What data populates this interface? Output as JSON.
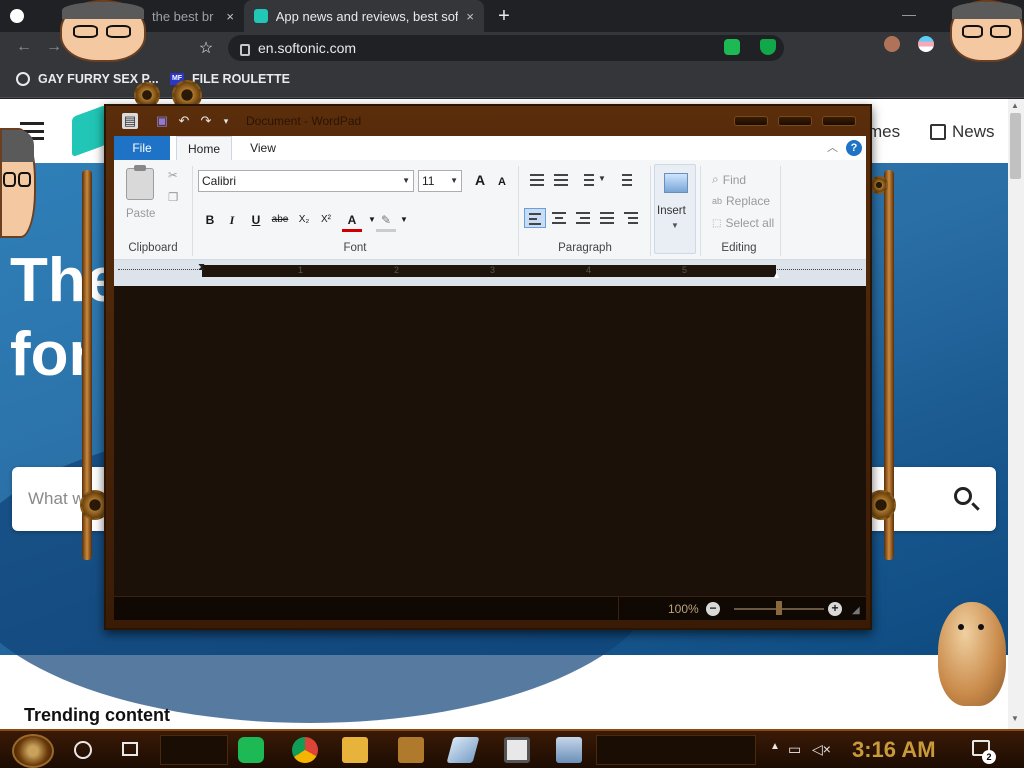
{
  "browser": {
    "tabs": [
      {
        "title": "the best br",
        "close": "×"
      },
      {
        "title": "App news and reviews, best soft",
        "close": "×"
      }
    ],
    "new_tab": "+",
    "minimize": "—",
    "address": "en.softonic.com",
    "bookmarks": [
      {
        "label": "GAY FURRY SEX P..."
      },
      {
        "label": "FILE ROULETTE",
        "badge": "MF"
      }
    ]
  },
  "page": {
    "nav": [
      "mes",
      "News"
    ],
    "hero_lines": [
      "The",
      "for"
    ],
    "search_placeholder": "What wo",
    "section_title": "Trending content"
  },
  "wordpad": {
    "title": "Document - WordPad",
    "tabs": {
      "file": "File",
      "home": "Home",
      "view": "View"
    },
    "help": "?",
    "groups": {
      "clipboard": {
        "label": "Clipboard",
        "paste": "Paste"
      },
      "font": {
        "label": "Font",
        "family": "Calibri",
        "size": "11",
        "bold": "B",
        "italic": "I",
        "underline": "U",
        "strike": "abe",
        "subscript": "X₂",
        "superscript": "X²",
        "grow": "A",
        "shrink": "A",
        "color": "A"
      },
      "paragraph": {
        "label": "Paragraph"
      },
      "insert": {
        "label": "Insert"
      },
      "editing": {
        "label": "Editing",
        "find": "Find",
        "replace": "Replace",
        "select_all": "Select all"
      }
    },
    "ruler_numbers": [
      "1",
      "2",
      "3",
      "4",
      "5"
    ],
    "zoom": "100%"
  },
  "taskbar": {
    "time": "3:16 AM",
    "notifications": "2"
  },
  "colors": {
    "chrome_bg": "#202124",
    "wordpad_accent": "#1e73c6",
    "hero_blue": "#2a6fa6",
    "steampunk_brass": "#c99a3a"
  },
  "icons": {
    "back": "←",
    "forward": "→",
    "reload": "↻",
    "bookmark": "☆"
  }
}
